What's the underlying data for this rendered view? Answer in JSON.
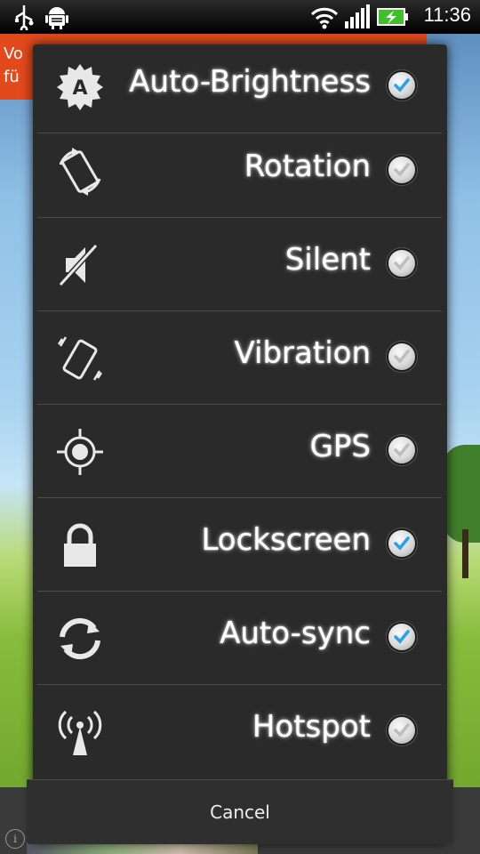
{
  "status_bar": {
    "time": "11:36",
    "icons": [
      "usb-icon",
      "android-debug-icon",
      "wifi-icon",
      "signal-icon",
      "battery-charging-icon"
    ]
  },
  "background": {
    "ad_line1": "Vo",
    "ad_line2": "fü"
  },
  "dialog": {
    "items": [
      {
        "label": "Auto-Brightness",
        "icon": "auto-brightness-icon",
        "checked": true
      },
      {
        "label": "Rotation",
        "icon": "rotation-icon",
        "checked": false
      },
      {
        "label": "Silent",
        "icon": "silent-icon",
        "checked": false
      },
      {
        "label": "Vibration",
        "icon": "vibration-icon",
        "checked": false
      },
      {
        "label": "GPS",
        "icon": "gps-icon",
        "checked": false
      },
      {
        "label": "Lockscreen",
        "icon": "lock-icon",
        "checked": true
      },
      {
        "label": "Auto-sync",
        "icon": "sync-icon",
        "checked": true
      },
      {
        "label": "Hotspot",
        "icon": "hotspot-icon",
        "checked": false
      }
    ],
    "cancel_label": "Cancel"
  },
  "colors": {
    "check_accent": "#2aa0e6",
    "dialog_bg": "#2a2a2a",
    "ad_bg": "#e2491c"
  }
}
